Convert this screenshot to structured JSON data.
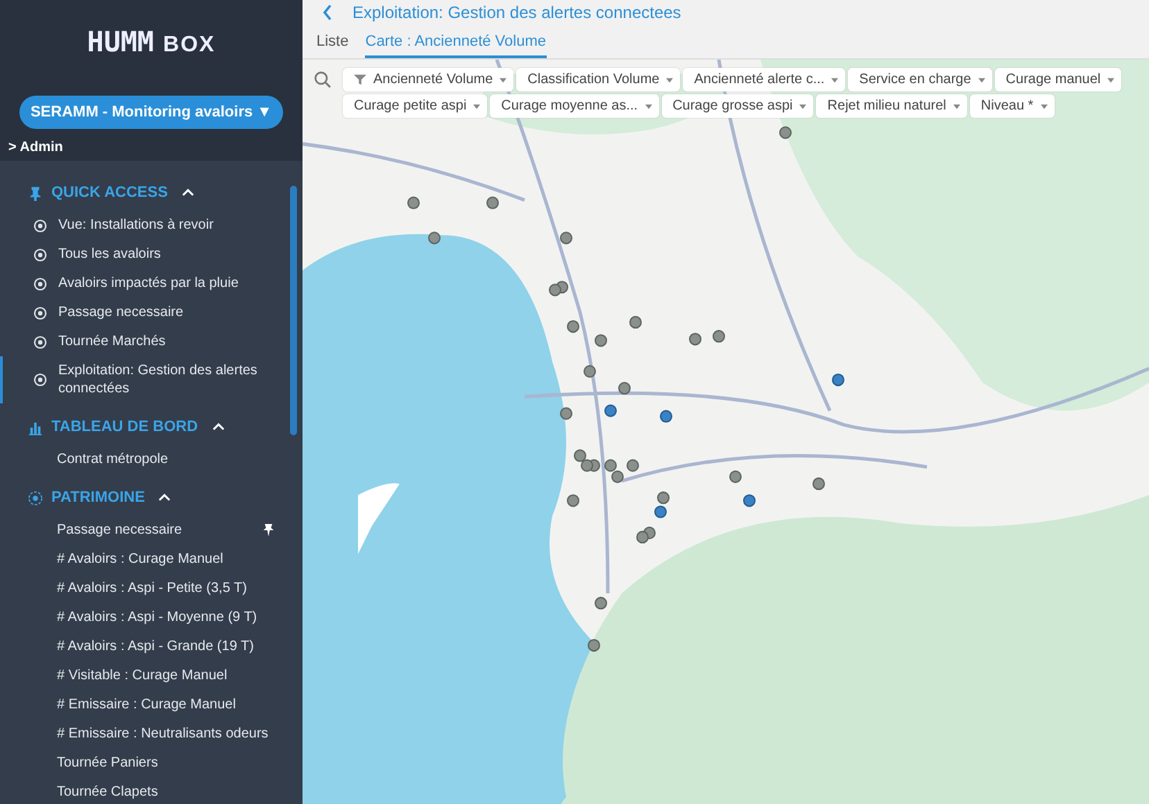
{
  "sidebar": {
    "logo": {
      "mark": "HUMM",
      "suffix": "BOX"
    },
    "workspace": {
      "label": "SERAMM - Monitoring avaloirs",
      "caret": "▼"
    },
    "admin": {
      "chevron": ">",
      "label": "Admin"
    },
    "sections": [
      {
        "title": "QUICK ACCESS",
        "kind": "pin",
        "expanded": true,
        "items": [
          {
            "label": "Vue: Installations à revoir",
            "kind": "radio",
            "selected": false,
            "pinned": false
          },
          {
            "label": "Tous les avaloirs",
            "kind": "radio",
            "selected": false,
            "pinned": false
          },
          {
            "label": "Avaloirs impactés par la pluie",
            "kind": "radio",
            "selected": false,
            "pinned": false
          },
          {
            "label": "Passage necessaire",
            "kind": "radio",
            "selected": false,
            "pinned": false
          },
          {
            "label": "Tournée Marchés",
            "kind": "radio",
            "selected": false,
            "pinned": false
          },
          {
            "label": "Exploitation: Gestion des alertes connectées",
            "kind": "radio",
            "selected": true,
            "pinned": false
          }
        ]
      },
      {
        "title": "TABLEAU DE BORD",
        "kind": "chart",
        "expanded": true,
        "items": [
          {
            "label": "Contrat métropole",
            "kind": "plain",
            "selected": false,
            "pinned": false
          }
        ]
      },
      {
        "title": "PATRIMOINE",
        "kind": "target",
        "expanded": true,
        "items": [
          {
            "label": "Passage necessaire",
            "kind": "plain",
            "selected": false,
            "pinned": true
          },
          {
            "label": "# Avaloirs : Curage Manuel",
            "kind": "plain",
            "selected": false,
            "pinned": false
          },
          {
            "label": "# Avaloirs : Aspi - Petite (3,5 T)",
            "kind": "plain",
            "selected": false,
            "pinned": false
          },
          {
            "label": "# Avaloirs : Aspi - Moyenne (9 T)",
            "kind": "plain",
            "selected": false,
            "pinned": false
          },
          {
            "label": "# Avaloirs : Aspi - Grande (19 T)",
            "kind": "plain",
            "selected": false,
            "pinned": false
          },
          {
            "label": "# Visitable : Curage Manuel",
            "kind": "plain",
            "selected": false,
            "pinned": false
          },
          {
            "label": "# Emissaire : Curage Manuel",
            "kind": "plain",
            "selected": false,
            "pinned": false
          },
          {
            "label": "# Emissaire : Neutralisants odeurs",
            "kind": "plain",
            "selected": false,
            "pinned": false
          },
          {
            "label": "Tournée Paniers",
            "kind": "plain",
            "selected": false,
            "pinned": false
          },
          {
            "label": "Tournée Clapets",
            "kind": "plain",
            "selected": false,
            "pinned": false
          }
        ]
      }
    ]
  },
  "header": {
    "title": "Exploitation: Gestion des alertes connectees"
  },
  "tabs": [
    {
      "label": "Liste",
      "selected": false
    },
    {
      "label": "Carte : Ancienneté Volume",
      "selected": true
    }
  ],
  "filter_rows": [
    [
      {
        "label": "Ancienneté Volume",
        "kind": "funnel"
      },
      {
        "label": "Classification Volume",
        "kind": "plain"
      },
      {
        "label": "Ancienneté alerte c...",
        "kind": "plain"
      },
      {
        "label": "Service en charge",
        "kind": "plain"
      },
      {
        "label": "Curage manuel",
        "kind": "plain"
      }
    ],
    [
      {
        "label": "Curage petite aspi",
        "kind": "plain"
      },
      {
        "label": "Curage moyenne as...",
        "kind": "plain"
      },
      {
        "label": "Curage grosse aspi",
        "kind": "plain"
      },
      {
        "label": "Rejet milieu naturel",
        "kind": "plain"
      },
      {
        "label": "Niveau *",
        "kind": "plain"
      }
    ]
  ]
}
